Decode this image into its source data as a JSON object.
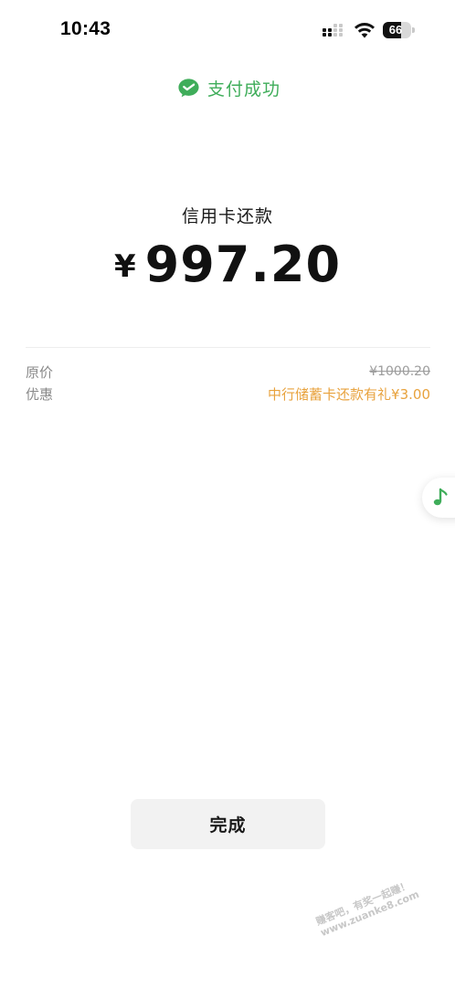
{
  "status_bar": {
    "time": "10:43",
    "battery_level": "66",
    "battery_fraction": 0.66,
    "signal_icon": "signal-bars-icon",
    "wifi_icon": "wifi-icon"
  },
  "header": {
    "icon": "wechat-pay-icon",
    "title": "支付成功",
    "accent_color": "#3fad5a"
  },
  "payment": {
    "merchant": "信用卡还款",
    "currency_symbol": "¥",
    "amount": "997.20"
  },
  "details": {
    "original_price_label": "原价",
    "original_price_value": "¥1000.20",
    "discount_label": "优惠",
    "discount_value": "中行储蓄卡还款有礼¥3.00",
    "discount_color": "#e8a23d"
  },
  "floating_button": {
    "icon": "music-note-icon"
  },
  "actions": {
    "done_label": "完成"
  },
  "watermark": {
    "line1": "赚客吧，有奖一起赚！",
    "line2": "www.zuanke8.com"
  }
}
